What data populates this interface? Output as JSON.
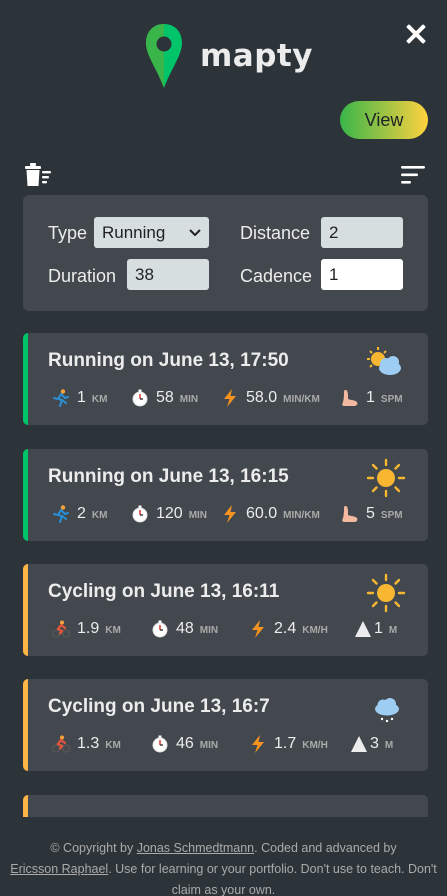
{
  "app": {
    "name": "mapty",
    "brand_color": "#00c46a",
    "accent_color": "#ffb545"
  },
  "header": {
    "view_label": "View",
    "close_icon": "close-icon"
  },
  "toolbar": {
    "delete_icon": "trash-icon",
    "sort_icon": "sort-icon"
  },
  "form": {
    "type_label": "Type",
    "type_value": "Running",
    "distance_label": "Distance",
    "distance_value": "2",
    "duration_label": "Duration",
    "duration_value": "38",
    "cadence_label": "Cadence",
    "cadence_value": "1"
  },
  "workouts": [
    {
      "type": "running",
      "title": "Running on June 13, 17:50",
      "weather": "partly-cloudy",
      "distance": "1",
      "distance_unit": "KM",
      "duration": "58",
      "duration_unit": "MIN",
      "pace": "58.0",
      "pace_unit": "MIN/KM",
      "cadence": "1",
      "cadence_unit": "SPM"
    },
    {
      "type": "running",
      "title": "Running on June 13, 16:15",
      "weather": "sunny",
      "distance": "2",
      "distance_unit": "KM",
      "duration": "120",
      "duration_unit": "MIN",
      "pace": "60.0",
      "pace_unit": "MIN/KM",
      "cadence": "5",
      "cadence_unit": "SPM"
    },
    {
      "type": "cycling",
      "title": "Cycling on June 13, 16:11",
      "weather": "sunny",
      "distance": "1.9",
      "distance_unit": "KM",
      "duration": "48",
      "duration_unit": "MIN",
      "speed": "2.4",
      "speed_unit": "KM/H",
      "elevation": "1",
      "elevation_unit": "M"
    },
    {
      "type": "cycling",
      "title": "Cycling on June 13, 16:7",
      "weather": "snow",
      "distance": "1.3",
      "distance_unit": "KM",
      "duration": "46",
      "duration_unit": "MIN",
      "speed": "1.7",
      "speed_unit": "KM/H",
      "elevation": "3",
      "elevation_unit": "M"
    }
  ],
  "footer": {
    "prefix": "© Copyright by ",
    "author_link": "Jonas Schmedtmann",
    "middle": ". Coded and advanced by ",
    "coder_link": "Ericsson Raphael",
    "suffix": ". Use for learning or your portfolio. Don't use to teach. Don't claim as your own."
  }
}
